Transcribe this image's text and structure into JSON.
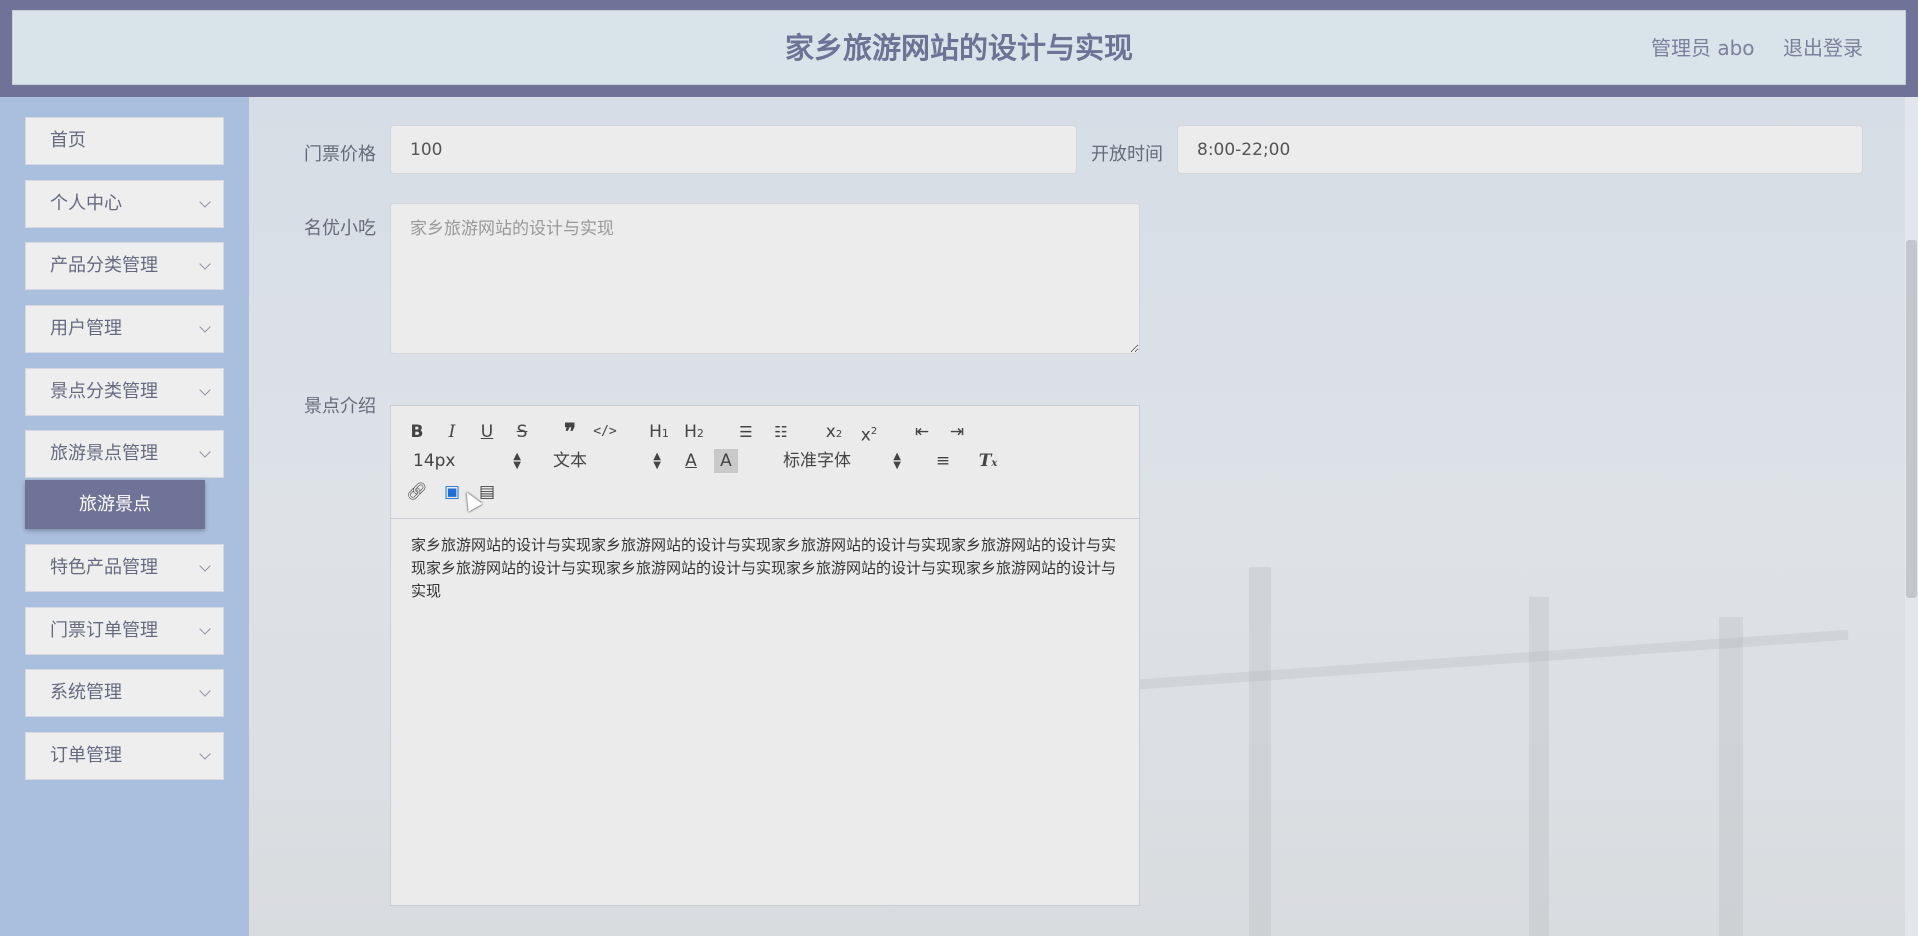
{
  "header": {
    "title": "家乡旅游网站的设计与实现",
    "user": "管理员 abo",
    "logout": "退出登录"
  },
  "sidebar": {
    "items": [
      {
        "label": "首页"
      },
      {
        "label": "个人中心"
      },
      {
        "label": "产品分类管理"
      },
      {
        "label": "用户管理"
      },
      {
        "label": "景点分类管理"
      },
      {
        "label": "旅游景点管理"
      },
      {
        "label": "特色产品管理"
      },
      {
        "label": "门票订单管理"
      },
      {
        "label": "系统管理"
      },
      {
        "label": "订单管理"
      }
    ],
    "sub_item": "旅游景点"
  },
  "form": {
    "ticket_price_label": "门票价格",
    "ticket_price_value": "100",
    "open_time_label": "开放时间",
    "open_time_value": "8:00-22;00",
    "snacks_label": "名优小吃",
    "snacks_placeholder": "家乡旅游网站的设计与实现",
    "intro_label": "景点介绍"
  },
  "editor": {
    "font_size": "14px",
    "paragraph_format": "文本",
    "font_family": "标准字体",
    "content": "家乡旅游网站的设计与实现家乡旅游网站的设计与实现家乡旅游网站的设计与实现家乡旅游网站的设计与实现家乡旅游网站的设计与实现家乡旅游网站的设计与实现家乡旅游网站的设计与实现家乡旅游网站的设计与实现",
    "toolbar_icons": [
      "bold-icon",
      "italic-icon",
      "underline-icon",
      "strikethrough-icon",
      "blockquote-icon",
      "code-icon",
      "h1-icon",
      "h2-icon",
      "ordered-list-icon",
      "bullet-list-icon",
      "subscript-icon",
      "superscript-icon",
      "outdent-icon",
      "indent-icon",
      "font-color-icon",
      "background-color-icon",
      "align-icon",
      "clear-format-icon",
      "link-icon",
      "image-icon",
      "video-icon"
    ]
  },
  "colors": {
    "topbar": "#6f7397",
    "header_bg": "#d8e3ea",
    "sidebar_bg": "#a9bfdd",
    "sub_item_bg": "#6f7397"
  }
}
